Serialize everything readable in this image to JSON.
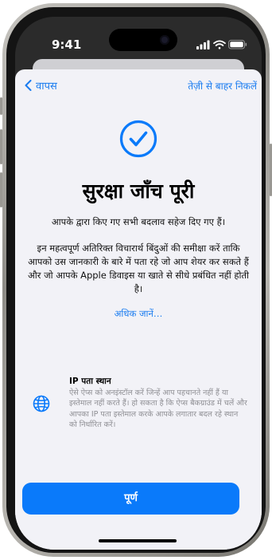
{
  "status_bar": {
    "time": "9:41",
    "icons": [
      "signal-icon",
      "wifi-icon",
      "battery-icon"
    ]
  },
  "nav": {
    "back_label": "वापस",
    "exit_label": "तेज़ी से बाहर निकलें"
  },
  "header": {
    "icon": "checkmark-circle-icon",
    "title": "सुरक्षा जाँच पूरी",
    "subtitle": "आपके द्वारा किए गए सभी बदलाव सहेज दिए गए हैं।"
  },
  "body_text": "इन महत्वपूर्ण अतिरिक्त विचारार्थ बिंदुओं की समीक्षा करें ताकि आपको उस जानकारी के बारे में पता रहे जो आप शेयर कर सकते हैं और जो आपके Apple डिवाइस या खाते से सीधे प्रबंधित नहीं होती है।",
  "learn_more_label": "अधिक जानें…",
  "feature": {
    "icon": "globe-icon",
    "title": "IP पता स्थान",
    "description": "ऐसे ऐप्स को अनइंस्टॉल करें जिन्हें आप पहचानते नहीं हैं या इस्तेमाल नहीं करते हैं। हो सकता है कि ऐप्स बैकग्राउंड में चलें और आपका IP पता इस्तेमाल करके आपके लगातार बदल रहे स्थान को निर्धारित करें।"
  },
  "footer": {
    "done_label": "पूर्ण"
  },
  "colors": {
    "accent": "#0a7afa",
    "link": "#1a7cf0",
    "sheet_background": "#f2f2f7",
    "secondary_text": "#8e8e93"
  }
}
